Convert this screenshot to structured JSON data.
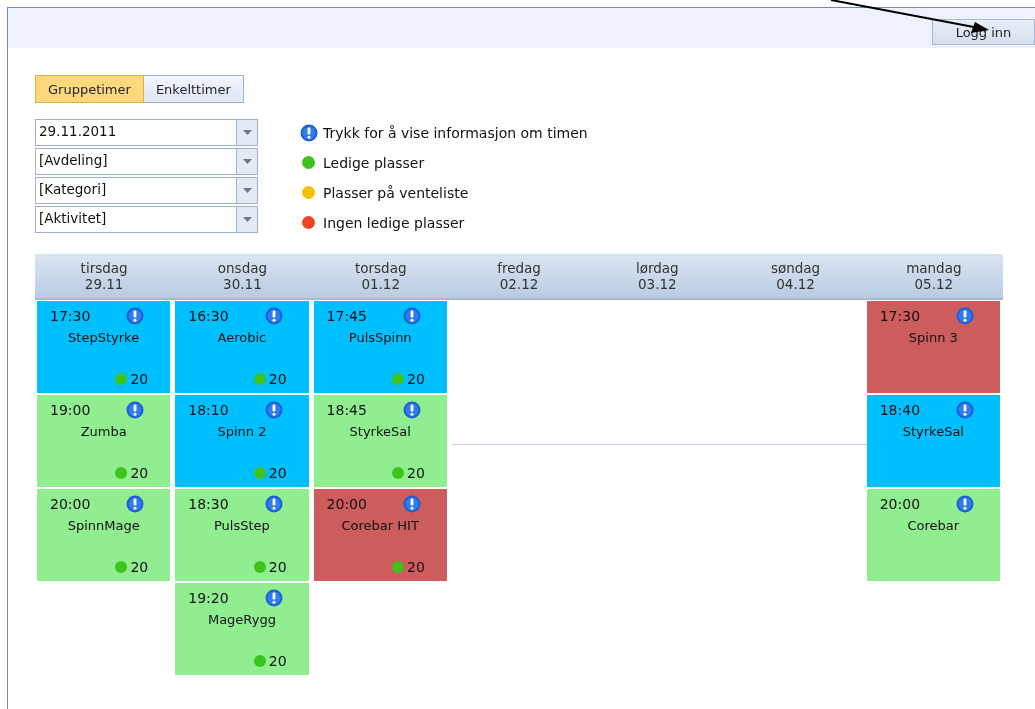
{
  "header": {
    "login_button": "Logg inn"
  },
  "tabs": [
    {
      "label": "Gruppetimer",
      "selected": true
    },
    {
      "label": "Enkelttimer",
      "selected": false
    }
  ],
  "filters": [
    {
      "value": "29.11.2011"
    },
    {
      "value": "[Avdeling]"
    },
    {
      "value": "[Kategori]"
    },
    {
      "value": "[Aktivitet]"
    }
  ],
  "legend": [
    {
      "kind": "info",
      "label": "Trykk for å vise informasjon om timen"
    },
    {
      "kind": "dot",
      "color": "#3ec21c",
      "label": "Ledige plasser"
    },
    {
      "kind": "dot",
      "color": "#f2c200",
      "label": "Plasser på venteliste"
    },
    {
      "kind": "dot",
      "color": "#ee4422",
      "label": "Ingen ledige plasser"
    }
  ],
  "days": [
    {
      "name": "tirsdag",
      "date": "29.11",
      "classes": [
        {
          "time": "17:30",
          "name": "StepStyrke",
          "color": "#00bfff",
          "spots": {
            "count": "20",
            "color": "#3ec21c"
          }
        },
        {
          "time": "19:00",
          "name": "Zumba",
          "color": "#90ee90",
          "spots": {
            "count": "20",
            "color": "#3ec21c"
          }
        },
        {
          "time": "20:00",
          "name": "SpinnMage",
          "color": "#90ee90",
          "spots": {
            "count": "20",
            "color": "#3ec21c"
          }
        }
      ]
    },
    {
      "name": "onsdag",
      "date": "30.11",
      "classes": [
        {
          "time": "16:30",
          "name": "Aerobic",
          "color": "#00bfff",
          "spots": {
            "count": "20",
            "color": "#3ec21c"
          }
        },
        {
          "time": "18:10",
          "name": "Spinn 2",
          "color": "#00bfff",
          "spots": {
            "count": "20",
            "color": "#3ec21c"
          }
        },
        {
          "time": "18:30",
          "name": "PulsStep",
          "color": "#90ee90",
          "spots": {
            "count": "20",
            "color": "#3ec21c"
          }
        },
        {
          "time": "19:20",
          "name": "MageRygg",
          "color": "#90ee90",
          "spots": {
            "count": "20",
            "color": "#3ec21c"
          }
        }
      ]
    },
    {
      "name": "torsdag",
      "date": "01.12",
      "classes": [
        {
          "time": "17:45",
          "name": "PulsSpinn",
          "color": "#00bfff",
          "spots": {
            "count": "20",
            "color": "#3ec21c"
          }
        },
        {
          "time": "18:45",
          "name": "StyrkeSal",
          "color": "#90ee90",
          "spots": {
            "count": "20",
            "color": "#3ec21c"
          }
        },
        {
          "time": "20:00",
          "name": "Corebar HIT",
          "color": "#cd5c5c",
          "spots": {
            "count": "20",
            "color": "#3ec21c"
          }
        }
      ]
    },
    {
      "name": "fredag",
      "date": "02.12"
    },
    {
      "name": "lørdag",
      "date": "03.12"
    },
    {
      "name": "søndag",
      "date": "04.12"
    },
    {
      "name": "mandag",
      "date": "05.12",
      "classes": [
        {
          "time": "17:30",
          "name": "Spinn 3",
          "color": "#cd5c5c"
        },
        {
          "time": "18:40",
          "name": "StyrkeSal",
          "color": "#00bfff"
        },
        {
          "time": "20:00",
          "name": "Corebar",
          "color": "#90ee90"
        }
      ]
    }
  ]
}
